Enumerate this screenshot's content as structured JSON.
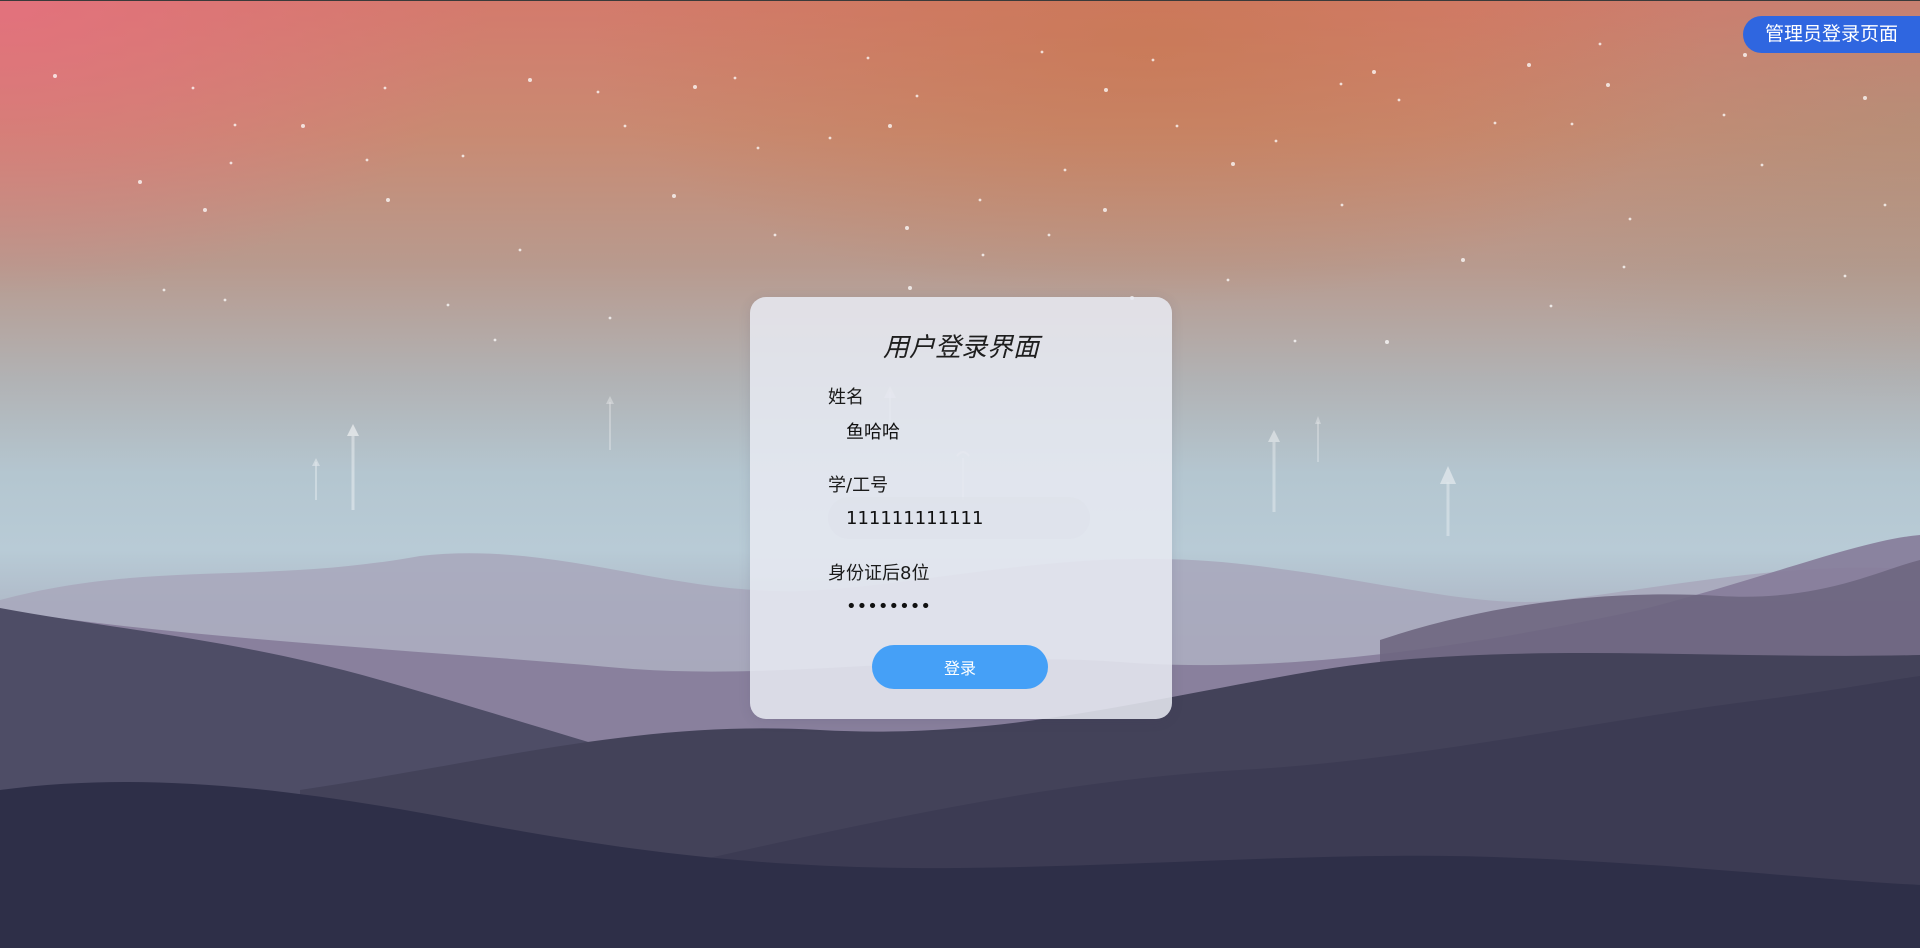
{
  "admin_button": {
    "label": "管理员登录页面"
  },
  "login_card": {
    "title": "用户登录界面",
    "fields": [
      {
        "label": "姓名",
        "value": "鱼哈哈",
        "type": "text"
      },
      {
        "label": "学/工号",
        "value": "111111111111",
        "type": "text"
      },
      {
        "label": "身份证后8位",
        "value": "12345678",
        "type": "password"
      }
    ],
    "submit_label": "登录"
  },
  "colors": {
    "admin_button_bg": "#2f66e0",
    "login_button_bg": "#45a0f7",
    "card_bg": "#e8eaf2"
  }
}
